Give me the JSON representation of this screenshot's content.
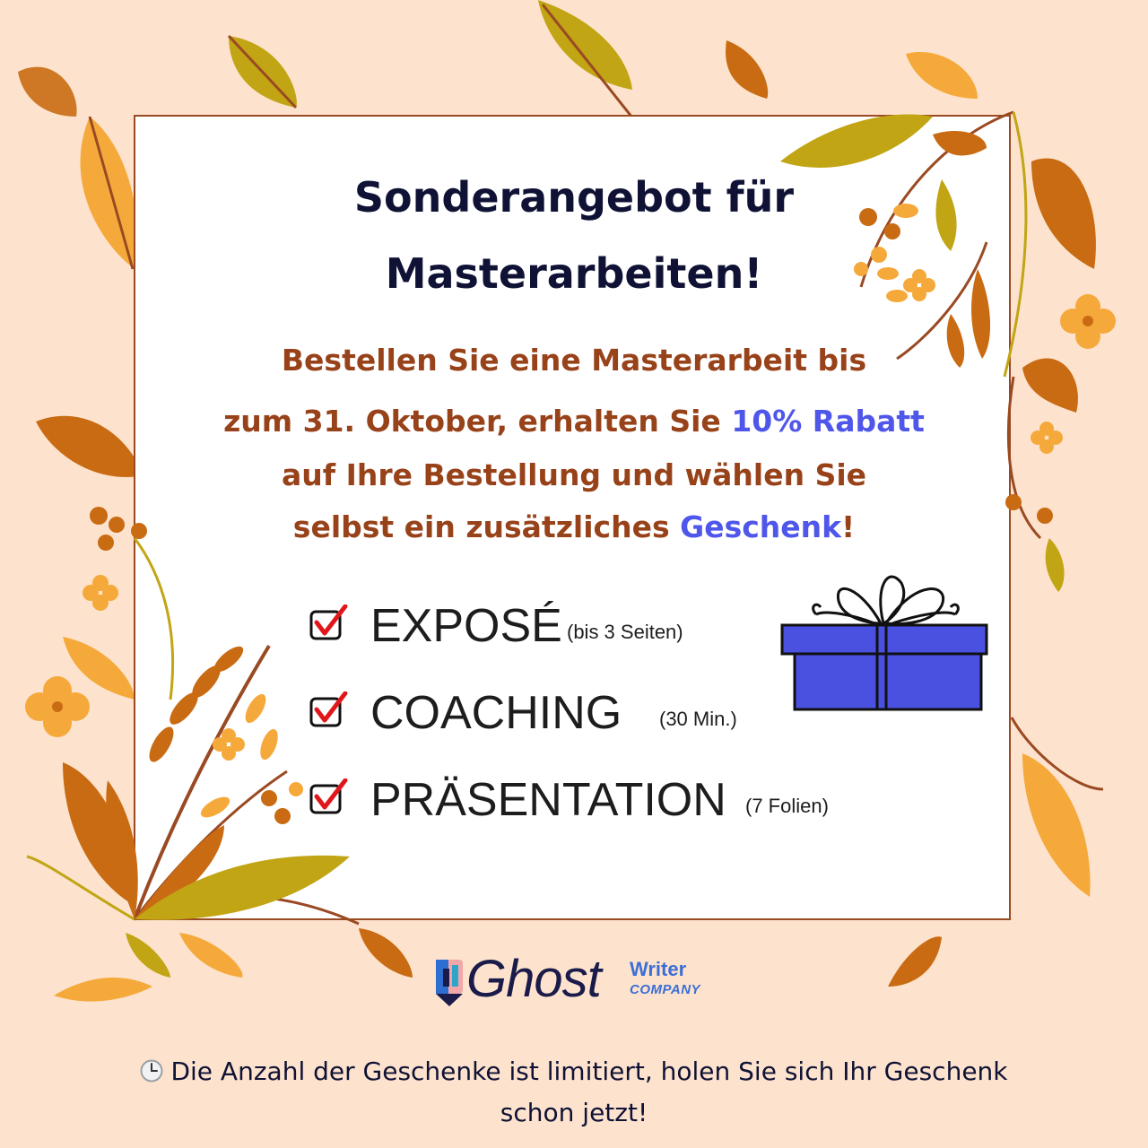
{
  "title": {
    "line1": "Sonderangebot für",
    "line2": "Masterarbeiten!"
  },
  "promo": {
    "line1": "Bestellen Sie eine Masterarbeit bis",
    "line2_before": "zum 31. Oktober, erhalten Sie ",
    "line2_highlight": "10% Rabatt",
    "line3": "auf Ihre Bestellung und wählen Sie",
    "line4_before": "selbst ein zusätzliches ",
    "line4_highlight": "Geschenk",
    "line4_after": "!"
  },
  "gifts": [
    {
      "label": "EXPOSÉ",
      "note": "(bis 3 Seiten)"
    },
    {
      "label": "COACHING",
      "note": "(30 Min.)"
    },
    {
      "label": "PRÄSENTATION",
      "note": "(7 Folien)"
    }
  ],
  "logo": {
    "ghost": "Ghost",
    "writer": "Writer",
    "company": "COMPANY"
  },
  "footer": {
    "line1": "Die Anzahl der Geschenke ist limitiert, holen Sie sich Ihr Geschenk",
    "line2": "schon jetzt!"
  },
  "colors": {
    "background": "#fde3cd",
    "frame": "#9a4a22",
    "title": "#0f1235",
    "promo": "#98421a",
    "highlight": "#4f56ea",
    "gift_box": "#4a50e0",
    "leaf_orange": "#f6a93b",
    "leaf_olive": "#c1a514",
    "leaf_dark": "#c96b13"
  },
  "icons": {
    "check": "checkbox-check-icon",
    "gift": "gift-box-icon",
    "clock": "clock-icon",
    "logo": "pencil-logo-icon"
  }
}
